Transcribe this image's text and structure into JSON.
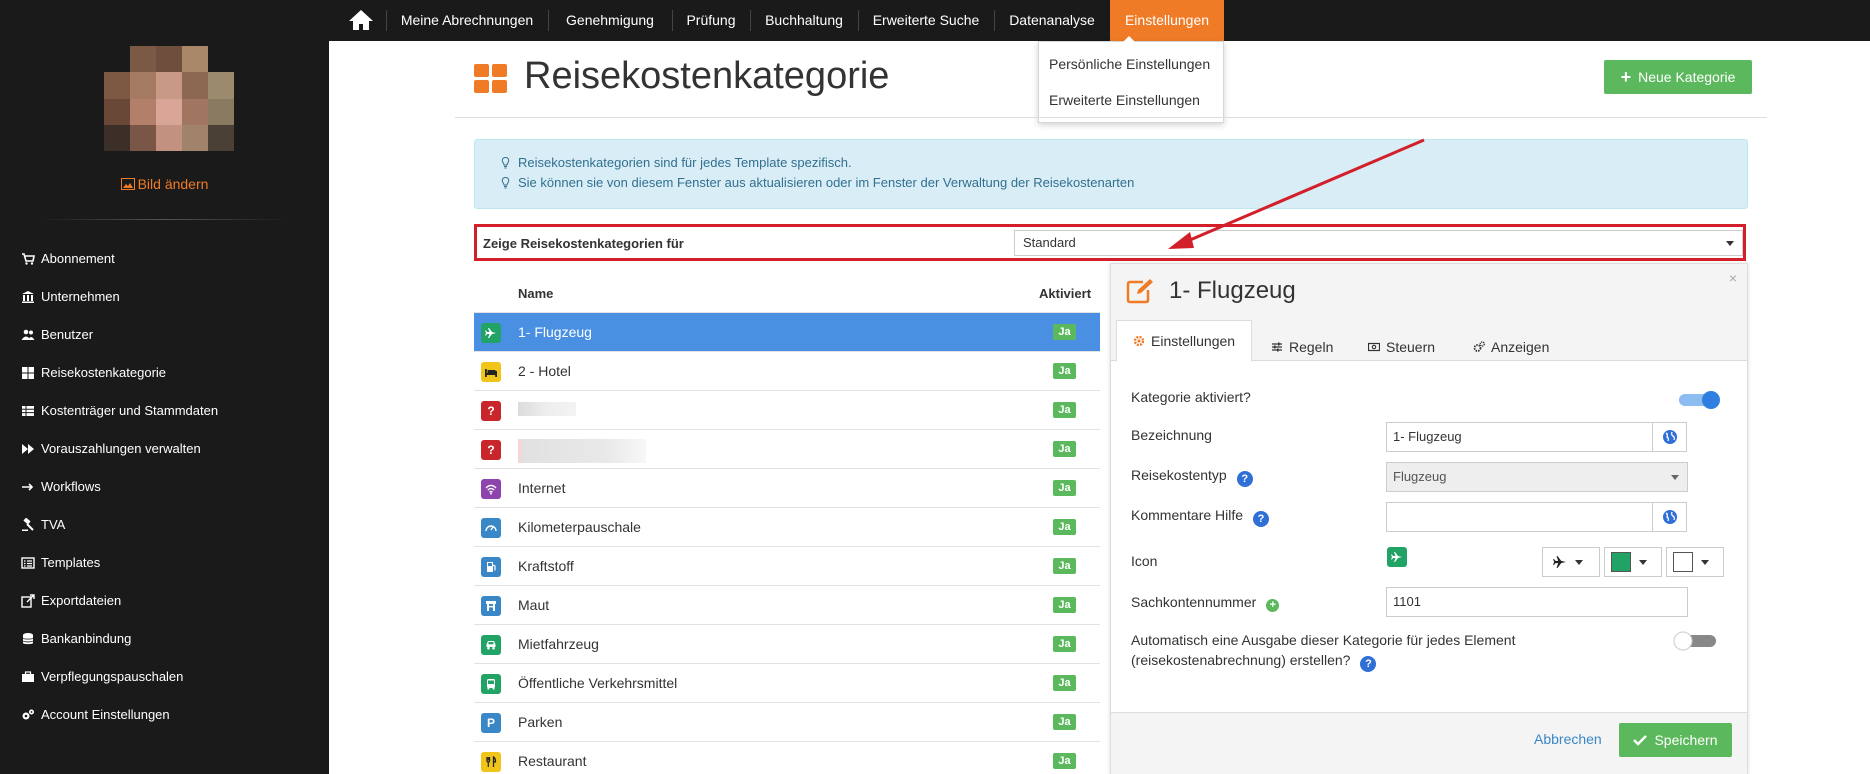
{
  "nav": {
    "items": [
      "Meine Abrechnungen",
      "Genehmigung",
      "Prüfung",
      "Buchhaltung",
      "Erweiterte Suche",
      "Datenanalyse",
      "Einstellungen"
    ],
    "active": "Einstellungen",
    "dropdown": [
      "Persönliche Einstellungen",
      "Erweiterte Einstellungen"
    ]
  },
  "sidebar": {
    "change_image": "Bild ändern",
    "items": [
      {
        "label": "Abonnement",
        "icon": "cart-icon"
      },
      {
        "label": "Unternehmen",
        "icon": "bank-icon"
      },
      {
        "label": "Benutzer",
        "icon": "users-icon"
      },
      {
        "label": "Reisekostenkategorie",
        "icon": "grid-icon"
      },
      {
        "label": "Kostenträger und Stammdaten",
        "icon": "table-icon"
      },
      {
        "label": "Vorauszahlungen verwalten",
        "icon": "fast-forward-icon"
      },
      {
        "label": "Workflows",
        "icon": "arrow-right-icon"
      },
      {
        "label": "TVA",
        "icon": "gavel-icon"
      },
      {
        "label": "Templates",
        "icon": "list-alt-icon"
      },
      {
        "label": "Exportdateien",
        "icon": "export-icon"
      },
      {
        "label": "Bankanbindung",
        "icon": "database-icon"
      },
      {
        "label": "Verpflegungspauschalen",
        "icon": "briefcase-icon"
      },
      {
        "label": "Account Einstellungen",
        "icon": "gears-icon"
      }
    ]
  },
  "page": {
    "title": "Reisekostenkategorie",
    "new_button": "Neue Kategorie",
    "info": [
      "Reisekostenkategorien sind für jedes Template spezifisch.",
      "Sie können sie von diesem Fenster aus aktualisieren oder im Fenster der Verwaltung der Reisekostenarten"
    ],
    "filter_label": "Zeige Reisekostenkategorien für",
    "filter_value": "Standard"
  },
  "list": {
    "col_name": "Name",
    "col_active": "Aktiviert",
    "rows": [
      {
        "name": "1- Flugzeug",
        "icon": "plane-icon",
        "color": "#21a366",
        "active": "Ja"
      },
      {
        "name": "2 - Hotel",
        "icon": "bed-icon",
        "color": "#f0c419",
        "active": "Ja"
      },
      {
        "name": "",
        "icon": "question-icon",
        "color": "#c9262c",
        "active": "Ja"
      },
      {
        "name": "",
        "icon": "question-icon",
        "color": "#c9262c",
        "active": "Ja"
      },
      {
        "name": "Internet",
        "icon": "wifi-icon",
        "color": "#8e44ad",
        "active": "Ja"
      },
      {
        "name": "Kilometerpauschale",
        "icon": "tachometer-icon",
        "color": "#3a87c7",
        "active": "Ja"
      },
      {
        "name": "Kraftstoff",
        "icon": "fuel-icon",
        "color": "#3a87c7",
        "active": "Ja"
      },
      {
        "name": "Maut",
        "icon": "toll-icon",
        "color": "#3a87c7",
        "active": "Ja"
      },
      {
        "name": "Mietfahrzeug",
        "icon": "car-icon",
        "color": "#21a366",
        "active": "Ja"
      },
      {
        "name": "Öffentliche Verkehrsmittel",
        "icon": "bus-icon",
        "color": "#21a366",
        "active": "Ja"
      },
      {
        "name": "Parken",
        "icon": "parking-icon",
        "color": "#3a87c7",
        "active": "Ja"
      },
      {
        "name": "Restaurant",
        "icon": "cutlery-icon",
        "color": "#f0c419",
        "active": "Ja"
      }
    ]
  },
  "panel": {
    "title": "1- Flugzeug",
    "close": "×",
    "tabs": [
      "Einstellungen",
      "Regeln",
      "Steuern",
      "Anzeigen"
    ],
    "fields": {
      "enabled_label": "Kategorie aktiviert?",
      "name_label": "Bezeichnung",
      "name_value": "1- Flugzeug",
      "type_label": "Reisekostentyp",
      "type_value": "Flugzeug",
      "help_label": "Kommentare Hilfe",
      "help_value": "",
      "icon_label": "Icon",
      "account_label": "Sachkontennummer",
      "account_value": "1101",
      "auto_label_1": "Automatisch eine Ausgabe dieser Kategorie für jedes Element",
      "auto_label_2": "(reisekostenabrechnung) erstellen?"
    },
    "cancel": "Abbrechen",
    "save": "Speichern",
    "icon_color": "#21a366"
  }
}
